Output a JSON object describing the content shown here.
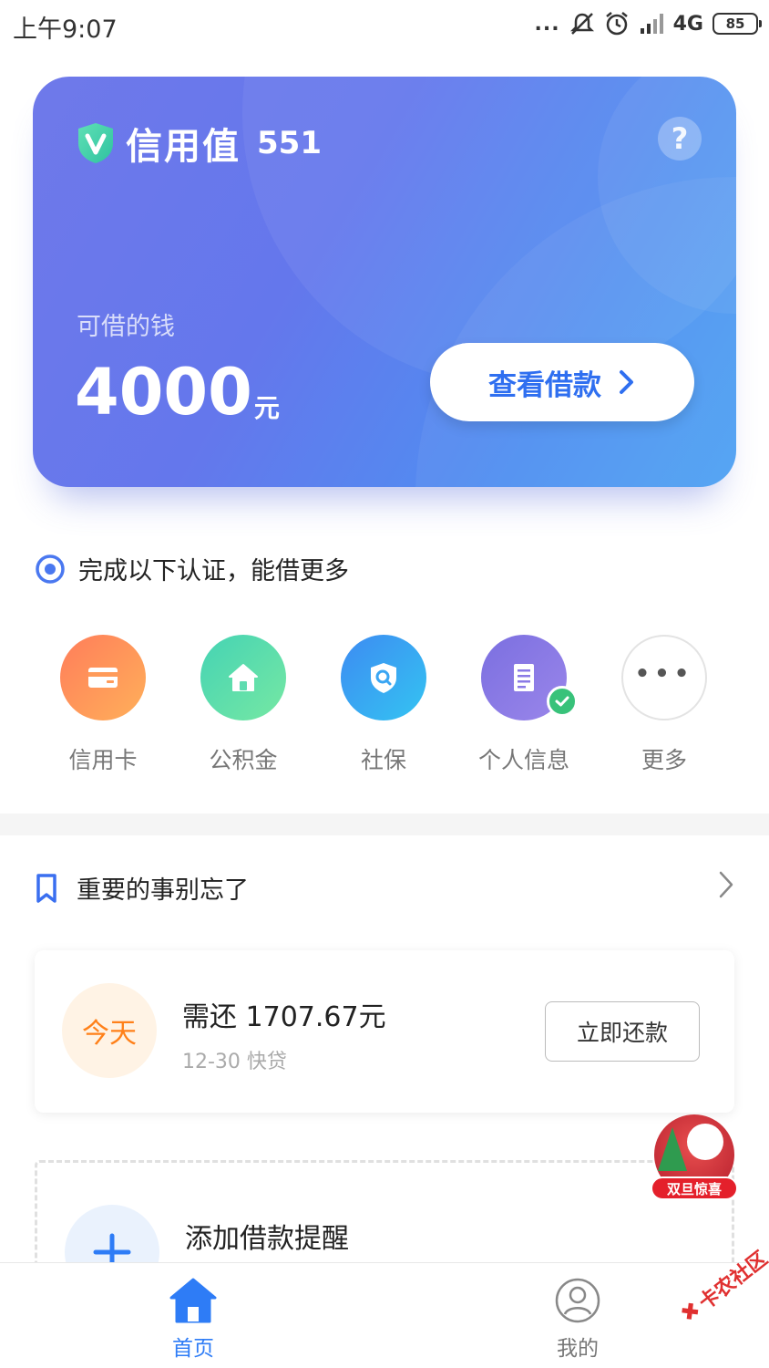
{
  "status_bar": {
    "time": "上午9:07",
    "dots": "...",
    "network": "4G",
    "battery": "85"
  },
  "credit_card": {
    "title": "信用值",
    "score": "551",
    "help": "?",
    "available_label": "可借的钱",
    "available_amount": "4000",
    "available_unit": "元",
    "view_button": "查看借款"
  },
  "certification": {
    "hint": "完成以下认证，能借更多",
    "items": [
      {
        "label": "信用卡",
        "icon": "credit-card-icon",
        "verified": false
      },
      {
        "label": "公积金",
        "icon": "house-icon",
        "verified": false
      },
      {
        "label": "社保",
        "icon": "shield-search-icon",
        "verified": false
      },
      {
        "label": "个人信息",
        "icon": "document-icon",
        "verified": true
      },
      {
        "label": "更多",
        "icon": "more-icon",
        "verified": false
      }
    ]
  },
  "reminders": {
    "title": "重要的事别忘了",
    "repay": {
      "badge": "今天",
      "amount": "需还 1707.67元",
      "sub": "12-30 快贷",
      "button": "立即还款"
    },
    "add_label": "添加借款提醒"
  },
  "promo": {
    "label": "双旦惊喜"
  },
  "bottom_nav": {
    "home": "首页",
    "mine": "我的"
  },
  "watermark": "卡农社区",
  "colors": {
    "accent": "#2e7cf6",
    "card_gradient_start": "#6f79ea",
    "card_gradient_end": "#4da2f3",
    "today_orange": "#ff8019",
    "verified_green": "#38c27a"
  }
}
